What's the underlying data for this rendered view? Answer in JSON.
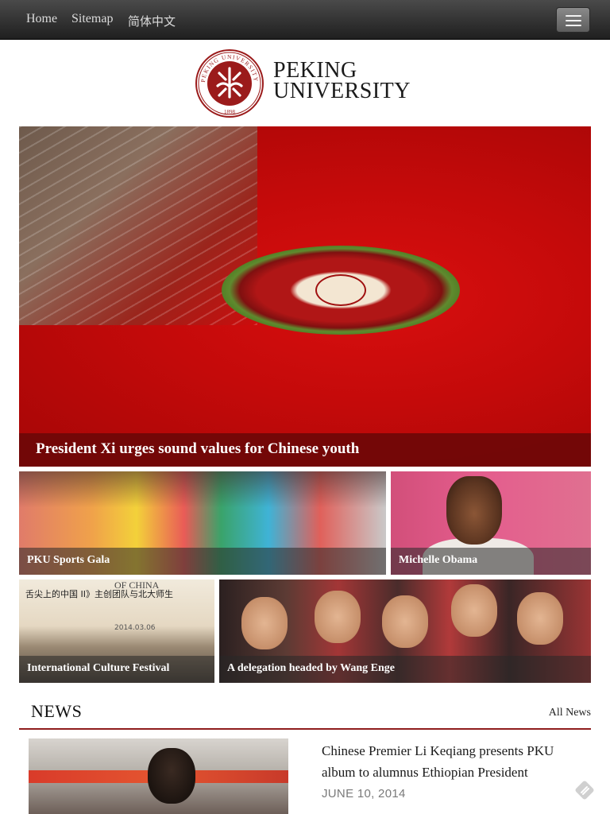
{
  "nav": {
    "links": [
      "Home",
      "Sitemap",
      "简体中文"
    ],
    "menu_icon": "hamburger-icon"
  },
  "logo": {
    "seal_top_text": "PEKING UNIVERSITY",
    "seal_year": "1898",
    "line1": "PEKING",
    "line2": "UNIVERSITY"
  },
  "hero": {
    "caption": "President Xi urges sound values for Chinese youth"
  },
  "tiles": [
    {
      "caption": "PKU Sports Gala"
    },
    {
      "caption": "Michelle Obama"
    },
    {
      "caption": "International Culture Festival",
      "banner_text": "舌尖上的中国 II》主创团队与北大师生",
      "banner_date": "2014.03.06",
      "banner_top": "OF CHINA"
    },
    {
      "caption": "A delegation headed by Wang Enge"
    }
  ],
  "news": {
    "title": "NEWS",
    "all_link": "All News",
    "items": [
      {
        "headline": "Chinese Premier Li Keqiang presents PKU album to alumnus Ethiopian President",
        "date": "JUNE 10, 2014"
      }
    ]
  },
  "colors": {
    "brand_red": "#8f1d1d",
    "hero_caption_bg": "#6e0808",
    "nav_bg": "#2e2e2e"
  }
}
